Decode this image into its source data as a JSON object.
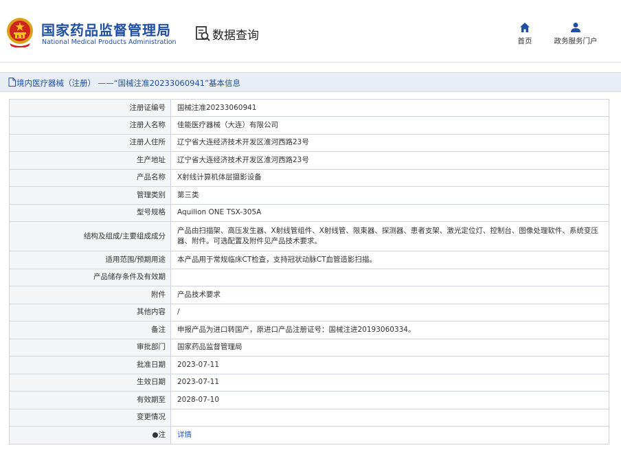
{
  "header": {
    "org_name_cn": "国家药品监督管理局",
    "org_name_en": "National Medical Products Administration",
    "section_title": "数据查询",
    "nav": {
      "home_label": "首页",
      "portal_label": "政务服务门户"
    }
  },
  "titlebar": {
    "text": "境内医疗器械（注册） ——“国械注准20233060941”基本信息"
  },
  "fields": {
    "reg_no": {
      "label": "注册证编号",
      "value": "国械注准20233060941"
    },
    "registrant": {
      "label": "注册人名称",
      "value": "佳能医疗器械（大连）有限公司"
    },
    "registrant_address": {
      "label": "注册人住所",
      "value": "辽宁省大连经济技术开发区淮河西路23号"
    },
    "production_address": {
      "label": "生产地址",
      "value": "辽宁省大连经济技术开发区淮河西路23号"
    },
    "product_name": {
      "label": "产品名称",
      "value": "X射线计算机体层摄影设备"
    },
    "management_class": {
      "label": "管理类别",
      "value": "第三类"
    },
    "model_spec": {
      "label": "型号规格",
      "value": "Aquilion ONE TSX-305A"
    },
    "structure": {
      "label": "结构及组成/主要组成成分",
      "value": "产品由扫描架、高压发生器、X射线管组件、X射线管、限束器、探测器、患者支架、激光定位灯、控制台、图像处理软件、系统变压器、附件。可选配置及附件见产品技术要求。"
    },
    "scope": {
      "label": "适用范围/预期用途",
      "value": "本产品用于常规临床CT检查，支持冠状动脉CT血管造影扫描。"
    },
    "storage": {
      "label": "产品储存条件及有效期",
      "value": ""
    },
    "attachment": {
      "label": "附件",
      "value": "产品技术要求"
    },
    "other": {
      "label": "其他内容",
      "value": "/"
    },
    "remark": {
      "label": "备注",
      "value": "申报产品为进口转国产，原进口产品注册证号：国械注进20193060334。"
    },
    "approval_dept": {
      "label": "审批部门",
      "value": "国家药品监督管理局"
    },
    "approval_date": {
      "label": "批准日期",
      "value": "2023-07-11"
    },
    "effective_date": {
      "label": "生效日期",
      "value": "2023-07-11"
    },
    "expiry_date": {
      "label": "有效期至",
      "value": "2028-07-10"
    },
    "change": {
      "label": "变更情况",
      "value": ""
    },
    "note": {
      "label": "●注",
      "value": "详情"
    }
  },
  "colors": {
    "brand_blue": "#1f4fa3",
    "link_blue": "#1f5fbf",
    "label_bg": "#f4f5f7",
    "titlebar_bg": "#e9eef4"
  },
  "icons": {
    "emblem": "national-emblem-icon",
    "query": "search-document-icon",
    "home": "home-icon",
    "portal": "user-icon",
    "doc": "document-icon"
  }
}
